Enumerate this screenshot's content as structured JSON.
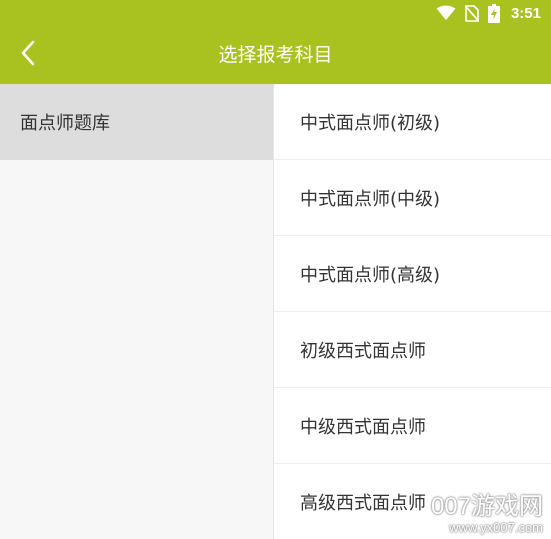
{
  "status_bar": {
    "time": "3:51",
    "icons": [
      "wifi-icon",
      "no-sim-icon",
      "battery-charging-icon"
    ]
  },
  "app_bar": {
    "title": "选择报考科目",
    "back_icon": "chevron-left-icon"
  },
  "categories": [
    {
      "label": "面点师题库",
      "selected": true
    }
  ],
  "subjects": [
    {
      "label": "中式面点师(初级)"
    },
    {
      "label": "中式面点师(中级)"
    },
    {
      "label": "中式面点师(高级)"
    },
    {
      "label": "初级西式面点师"
    },
    {
      "label": "中级西式面点师"
    },
    {
      "label": "高级西式面点师"
    }
  ],
  "watermark": {
    "text": "007游戏网",
    "url": "www.yx007.com"
  },
  "colors": {
    "accent": "#a9c21f",
    "selected_bg": "#dddddd",
    "left_pane_bg": "#f7f7f7",
    "text": "#333333"
  }
}
